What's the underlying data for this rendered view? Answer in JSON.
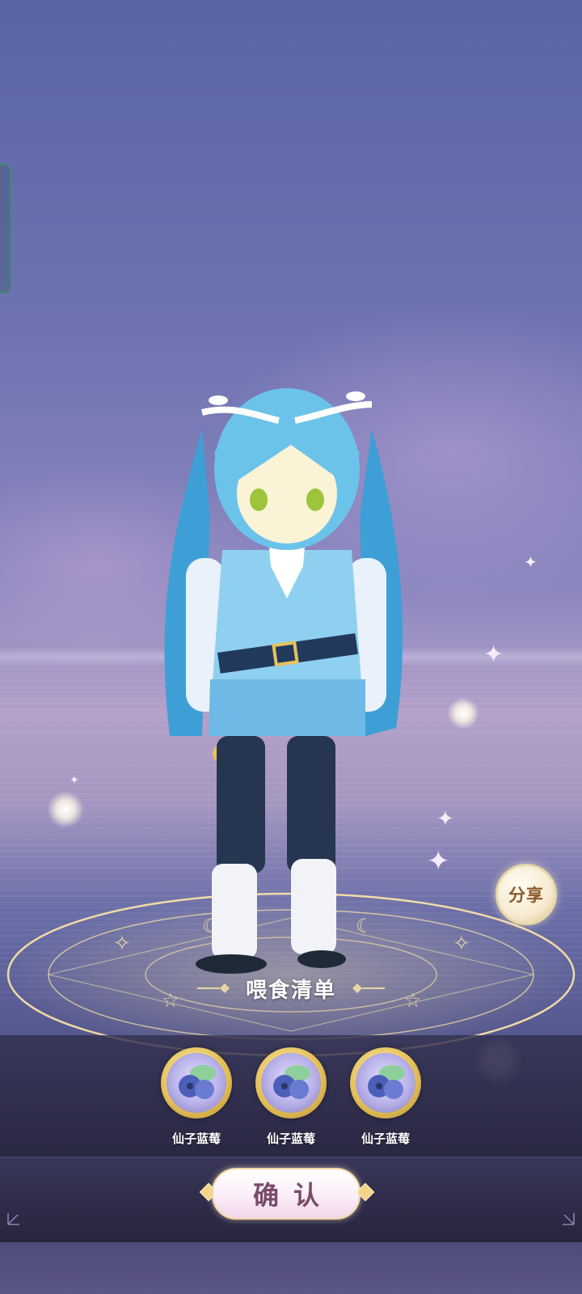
{
  "share": {
    "label": "分享"
  },
  "feed_list": {
    "title": "喂食清单",
    "items": [
      {
        "name": "仙子蓝莓",
        "icon": "fairy-blueberry-icon"
      },
      {
        "name": "仙子蓝莓",
        "icon": "fairy-blueberry-icon"
      },
      {
        "name": "仙子蓝莓",
        "icon": "fairy-blueberry-icon"
      }
    ]
  },
  "confirm": {
    "label": "确认"
  },
  "colors": {
    "sky_top": "#5a64a6",
    "hair": "#6cc3ea",
    "gold": "#e6c25a",
    "button_text": "#7a4b6a"
  }
}
